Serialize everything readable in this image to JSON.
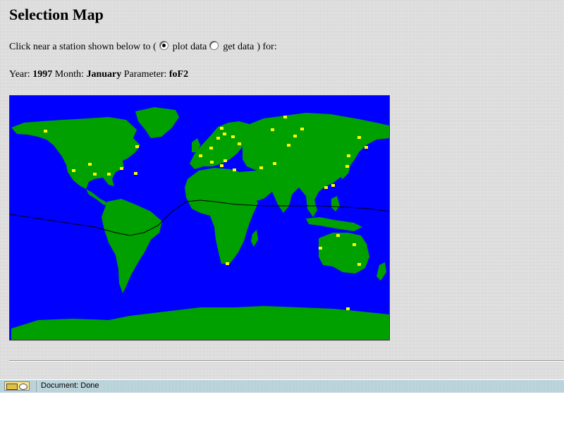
{
  "heading": "Selection Map",
  "instruction": {
    "prefix": "Click near a station shown below to (",
    "option_plot": "plot data",
    "option_get": "get data",
    "suffix": ") for:",
    "selected": "plot"
  },
  "selection": {
    "year_label": "Year:",
    "year": "1997",
    "month_label": "Month:",
    "month": "January",
    "parameter_label": "Parameter:",
    "parameter": "foF2"
  },
  "map": {
    "ocean_color": "#0000ff",
    "land_color": "#00a000",
    "station_color": "#ffff00",
    "equator_line_color": "#000000"
  },
  "status": {
    "text": "Document: Done"
  }
}
